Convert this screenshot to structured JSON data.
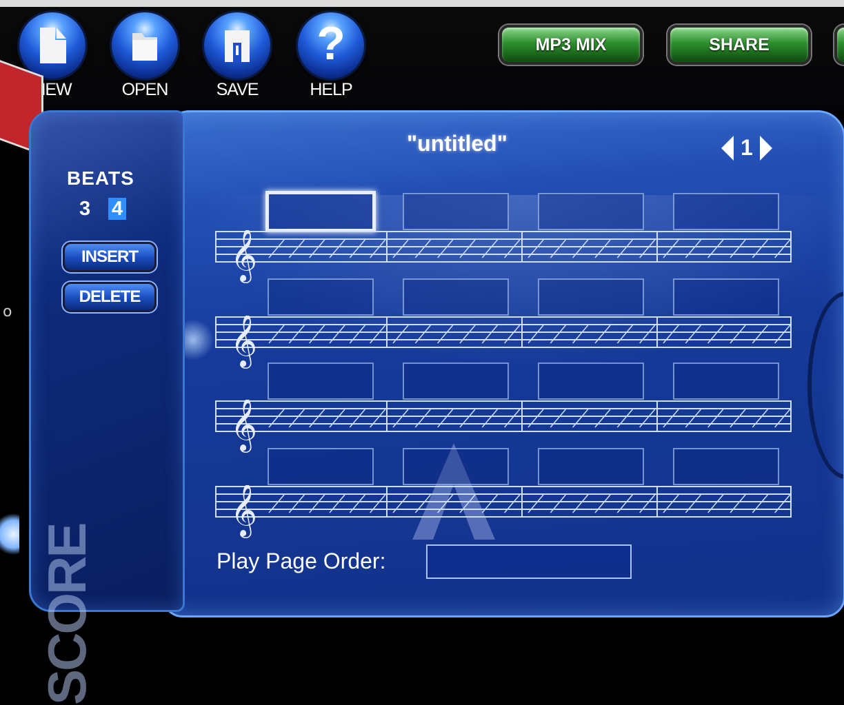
{
  "toolbar": {
    "new_label": "NEW",
    "open_label": "OPEN",
    "save_label": "SAVE",
    "help_label": "HELP",
    "help_glyph": "?",
    "mp3mix_label": "MP3 MIX",
    "share_label": "SHARE"
  },
  "sidebar": {
    "beats_title": "BEATS",
    "beat_options": [
      "3",
      "4"
    ],
    "selected_beat": "4",
    "insert_label": "INSERT",
    "delete_label": "DELETE",
    "section_label": "SCORE"
  },
  "score": {
    "title": "\"untitled\"",
    "page_number": "1",
    "staff_count": 4,
    "measures_per_staff": 4
  },
  "footer": {
    "play_order_label": "Play Page Order:",
    "play_order_value": ""
  },
  "edge": {
    "partial_text": "o"
  },
  "colors": {
    "panel_blue": "#163a9a",
    "accent_blue": "#2f8fff",
    "pill_green": "#2e8f2e",
    "tag_red": "#c0262b"
  }
}
